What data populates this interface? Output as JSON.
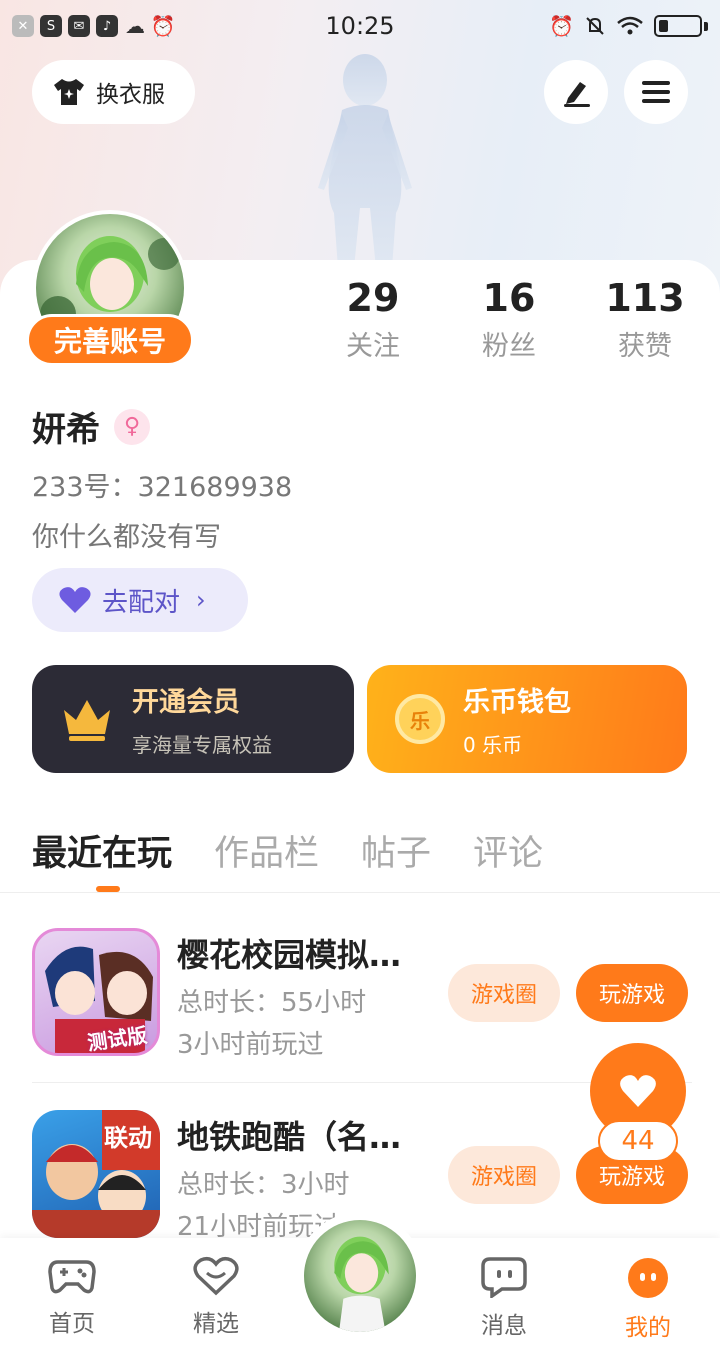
{
  "status_bar": {
    "time": "10:25",
    "left_icons": [
      "x-icon",
      "s-icon",
      "mail-icon",
      "music-icon",
      "cloud-icon",
      "alarm-icon"
    ],
    "right_icons": [
      "alarm-icon",
      "mute-icon",
      "wifi-icon",
      "battery-icon"
    ]
  },
  "header": {
    "dress_up_label": "换衣服"
  },
  "profile": {
    "complete_badge": "完善账号",
    "name": "妍希",
    "gender_symbol": "♀",
    "uid_label": "233号：",
    "uid_value": "321689938",
    "bio": "你什么都没有写",
    "match_label": "去配对"
  },
  "stats": [
    {
      "value": "29",
      "label": "关注"
    },
    {
      "value": "16",
      "label": "粉丝"
    },
    {
      "value": "113",
      "label": "获赞"
    }
  ],
  "promos": {
    "vip": {
      "title": "开通会员",
      "subtitle": "享海量专属权益"
    },
    "wallet": {
      "title": "乐币钱包",
      "subtitle": "0 乐币",
      "coin_symbol": "乐"
    }
  },
  "tabs": [
    "最近在玩",
    "作品栏",
    "帖子",
    "评论"
  ],
  "games": [
    {
      "name": "樱花校园模拟…",
      "duration": "总时长：55小时",
      "last_played": "3小时前玩过",
      "badge": "测试版",
      "circle_label": "游戏圈",
      "play_label": "玩游戏"
    },
    {
      "name": "地铁跑酷（名…",
      "duration": "总时长：3小时",
      "last_played": "21小时前玩过",
      "badge": "联动",
      "circle_label": "游戏圈",
      "play_label": "玩游戏"
    }
  ],
  "float_like": {
    "count": "44"
  },
  "bottom_nav": [
    {
      "label": "首页"
    },
    {
      "label": "精选"
    },
    {
      "label": "消息"
    },
    {
      "label": "我的"
    }
  ],
  "colors": {
    "accent": "#ff7a1a",
    "vip_bg": "#2c2b36",
    "match_text": "#5d55c8"
  }
}
